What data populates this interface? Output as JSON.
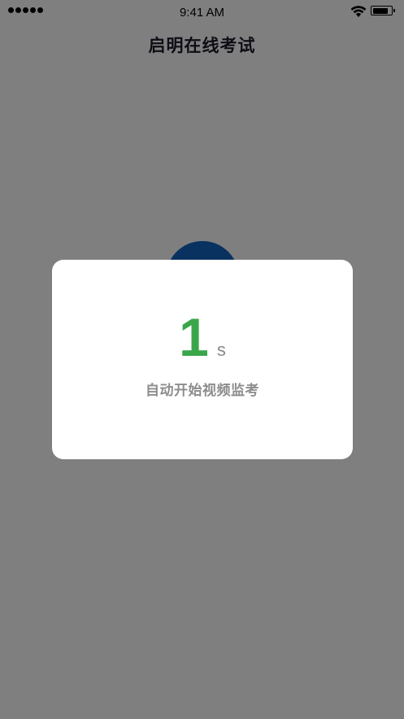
{
  "status_bar": {
    "time": "9:41 AM",
    "signal_icon": "cellular-signal-dots-icon",
    "wifi_icon": "wifi-icon",
    "battery_icon": "battery-icon",
    "battery_level": 0.9
  },
  "nav": {
    "title": "启明在线考试"
  },
  "modal": {
    "countdown_value": "1",
    "countdown_unit": "s",
    "message": "自动开始视频监考"
  },
  "colors": {
    "overlay": "#000000",
    "countdown": "#3aa64a",
    "circle": "#1565c0",
    "title": "#1b1b2b",
    "message": "#8c8c8c"
  }
}
